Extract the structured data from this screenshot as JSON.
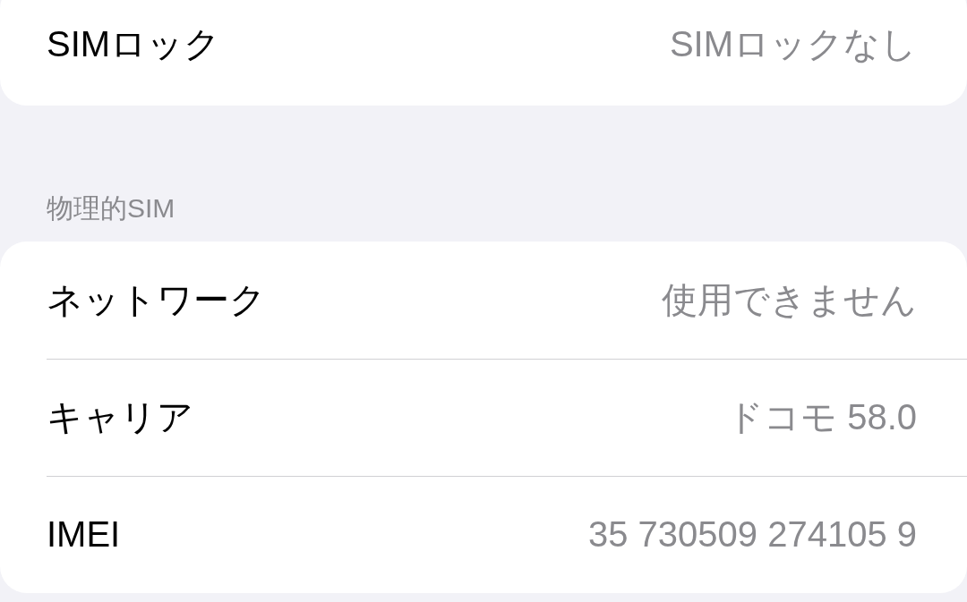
{
  "sections": [
    {
      "rows": [
        {
          "label": "SIMロック",
          "value": "SIMロックなし"
        }
      ]
    },
    {
      "header": "物理的SIM",
      "rows": [
        {
          "label": "ネットワーク",
          "value": "使用できません"
        },
        {
          "label": "キャリア",
          "value": "ドコモ 58.0"
        },
        {
          "label": "IMEI",
          "value": "35 730509 274105 9"
        }
      ]
    }
  ]
}
